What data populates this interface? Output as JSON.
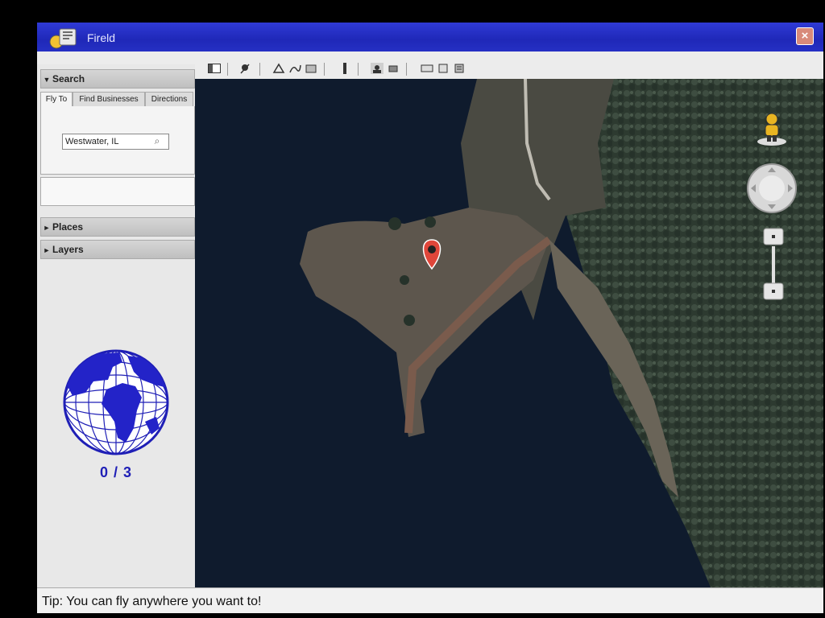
{
  "window": {
    "title": "Fireld",
    "close_label": "×"
  },
  "toolbar": {
    "icons": [
      "sidebar-toggle-icon",
      "placemark-icon",
      "polygon-icon",
      "path-icon",
      "overlay-icon",
      "ruler-icon",
      "email-icon",
      "print-icon",
      "view-in-maps-icon"
    ]
  },
  "sidebar": {
    "search": {
      "header": "Search",
      "tabs": [
        "Fly To",
        "Find Businesses",
        "Directions"
      ],
      "fly_to_value": "Westwater, IL"
    },
    "places": {
      "header": "Places"
    },
    "layers": {
      "header": "Layers"
    }
  },
  "progress": {
    "found": 0,
    "total": 3,
    "label": "0 / 3"
  },
  "status": {
    "tip": "Tip: You can fly anywhere you want to!"
  },
  "colors": {
    "titlebar": "#2530c4",
    "globe_ocean": "#2323c8",
    "counter_text": "#1f1fb6",
    "placemark": "#e0463a",
    "water": "#0e1a2c"
  }
}
